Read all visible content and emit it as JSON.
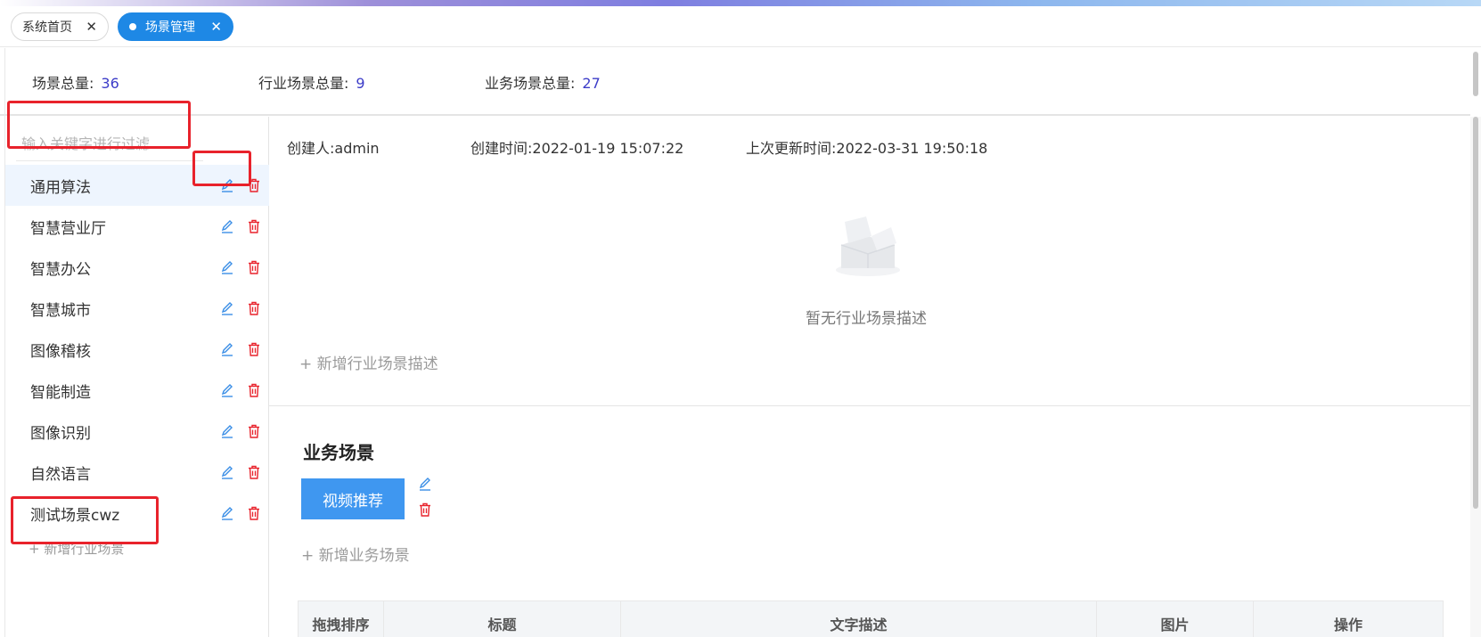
{
  "tabs": [
    {
      "label": "系统首页",
      "active": false
    },
    {
      "label": "场景管理",
      "active": true
    }
  ],
  "stats": {
    "total_label": "场景总量:",
    "total_value": "36",
    "industry_label": "行业场景总量:",
    "industry_value": "9",
    "business_label": "业务场景总量:",
    "business_value": "27"
  },
  "sidebar": {
    "filter_placeholder": "输入关键字进行过滤",
    "items": [
      {
        "label": "通用算法",
        "selected": true
      },
      {
        "label": "智慧营业厅"
      },
      {
        "label": "智慧办公"
      },
      {
        "label": "智慧城市"
      },
      {
        "label": "图像稽核"
      },
      {
        "label": "智能制造"
      },
      {
        "label": "图像识别"
      },
      {
        "label": "自然语言"
      },
      {
        "label": "测试场景cwz"
      }
    ],
    "add_label": "+ 新增行业场景"
  },
  "detail": {
    "creator": "创建人:admin",
    "created_at": "创建时间:2022-01-19 15:07:22",
    "updated_at": "上次更新时间:2022-03-31 19:50:18",
    "empty_text": "暂无行业场景描述",
    "add_desc_label": "+ 新增行业场景描述"
  },
  "business": {
    "title": "业务场景",
    "scene_button": "视频推荐",
    "add_label": "+ 新增业务场景",
    "table_headers": [
      "拖拽排序",
      "标题",
      "文字描述",
      "图片",
      "操作"
    ]
  },
  "colors": {
    "accent": "#1e88e5",
    "button": "#3f97f0",
    "stat_number": "#3c3cc8",
    "edit_icon": "#3a8ee6",
    "delete_icon": "#e8222b",
    "highlight": "#e8222b"
  }
}
